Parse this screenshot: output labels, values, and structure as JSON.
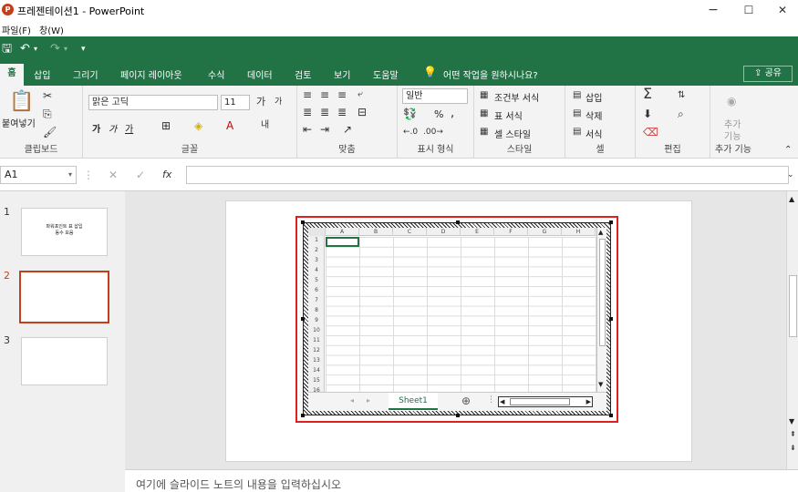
{
  "window": {
    "title": "프레젠테이션1 - PowerPoint",
    "app_icon_letter": "P",
    "minimize": "−",
    "maximize": "☐",
    "close": "✕"
  },
  "menubar": {
    "file": "파일(F)",
    "window": "창(W)"
  },
  "qat": {
    "save_icon": "save-icon",
    "undo_icon": "undo-icon",
    "redo_icon": "redo-icon",
    "customize_icon": "customize-icon"
  },
  "tabs": [
    "홈",
    "삽입",
    "그리기",
    "페이지 레이아웃",
    "수식",
    "데이터",
    "검토",
    "보기",
    "도움말"
  ],
  "tell_me": "어떤 작업을 원하시나요?",
  "share": "공유",
  "ribbon": {
    "clipboard": {
      "paste": "붙여넣기",
      "label": "클립보드"
    },
    "font": {
      "name": "맑은 고딕",
      "size": "11",
      "label": "글꼴",
      "bold": "가",
      "italic": "가",
      "underline": "가"
    },
    "alignment": {
      "label": "맞춤"
    },
    "number": {
      "format": "일반",
      "percent": "%",
      "comma": ",",
      "label": "표시 형식"
    },
    "styles": {
      "conditional": "조건부 서식",
      "table": "표 서식",
      "cell": "셀 스타일",
      "label": "스타일"
    },
    "cells": {
      "insert": "삽입",
      "delete": "삭제",
      "format": "서식",
      "label": "셀"
    },
    "editing": {
      "label": "편집"
    },
    "addins": {
      "btn1": "추가",
      "btn2": "기능",
      "label": "추가 기능"
    }
  },
  "formula": {
    "cell": "A1",
    "fx": "fx",
    "cancel": "✕",
    "enter": "✓"
  },
  "slides": [
    {
      "num": "1",
      "text1": "파워포인트 표 삽입",
      "text2": "동수 모음"
    },
    {
      "num": "2"
    },
    {
      "num": "3"
    }
  ],
  "sheet": {
    "columns": [
      "A",
      "B",
      "C",
      "D",
      "E",
      "F",
      "G",
      "H"
    ],
    "rows": [
      "1",
      "2",
      "3",
      "4",
      "5",
      "6",
      "7",
      "8",
      "9",
      "10",
      "11",
      "12",
      "13",
      "14",
      "15",
      "16"
    ],
    "tab": "Sheet1"
  },
  "notes": {
    "placeholder": "여기에 슬라이드 노트의 내용을 입력하십시오"
  },
  "colors": {
    "accent": "#217346",
    "ppt": "#c43e1c",
    "selection": "#e02020"
  }
}
